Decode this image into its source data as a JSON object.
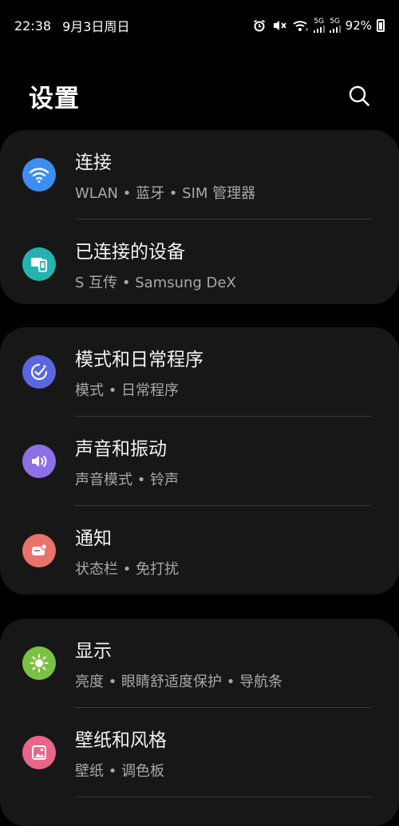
{
  "status_bar": {
    "time": "22:38",
    "date": "9月3日周日",
    "battery": "92%",
    "signal1": "5G",
    "signal2": "5G"
  },
  "header": {
    "title": "设置"
  },
  "groups": [
    {
      "items": [
        {
          "title": "连接",
          "subtitle": "WLAN • 蓝牙 • SIM 管理器",
          "icon": "wifi-icon",
          "color": "#3d8ef2"
        },
        {
          "title": "已连接的设备",
          "subtitle": "S 互传 • Samsung DeX",
          "icon": "devices-icon",
          "color": "#27b3ad"
        }
      ]
    },
    {
      "items": [
        {
          "title": "模式和日常程序",
          "subtitle": "模式 • 日常程序",
          "icon": "modes-icon",
          "color": "#5a67e0"
        },
        {
          "title": "声音和振动",
          "subtitle": "声音模式 • 铃声",
          "icon": "sound-icon",
          "color": "#8b70e6"
        },
        {
          "title": "通知",
          "subtitle": "状态栏 • 免打扰",
          "icon": "notification-icon",
          "color": "#e9726a"
        }
      ]
    },
    {
      "items": [
        {
          "title": "显示",
          "subtitle": "亮度 • 眼睛舒适度保护 • 导航条",
          "icon": "brightness-icon",
          "color": "#7cc242"
        },
        {
          "title": "壁纸和风格",
          "subtitle": "壁纸 • 调色板",
          "icon": "wallpaper-icon",
          "color": "#e8668a"
        }
      ]
    }
  ]
}
